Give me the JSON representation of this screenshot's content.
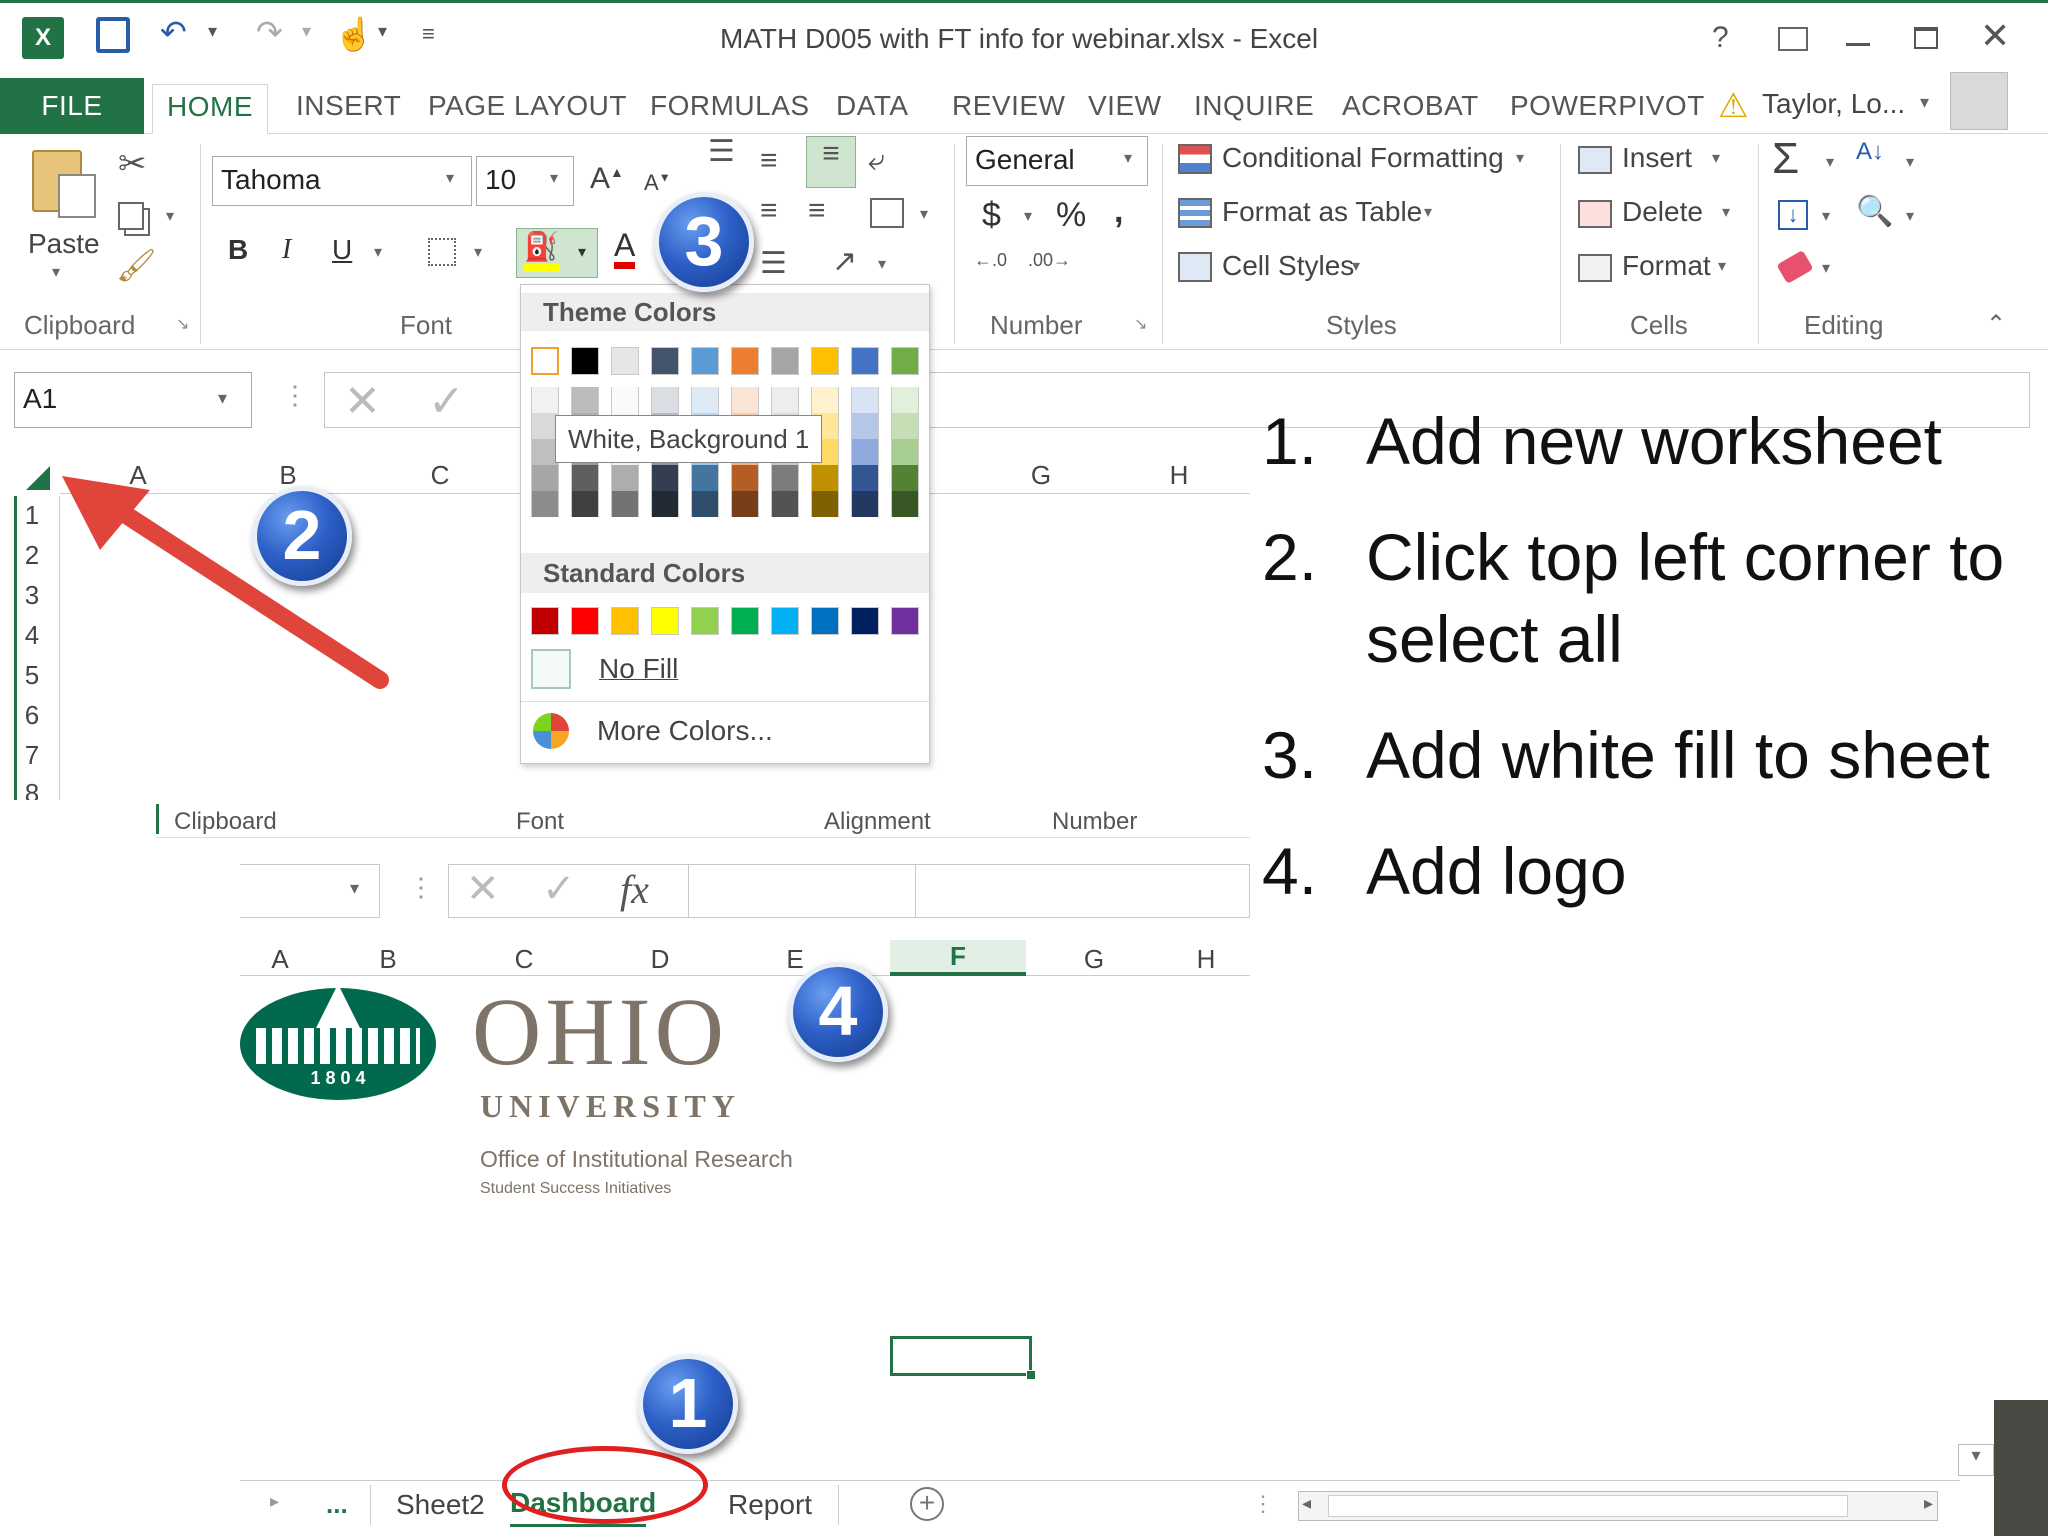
{
  "window": {
    "title": "MATH D005 with FT info for webinar.xlsx - Excel",
    "help": "?",
    "user": "Taylor, Lo..."
  },
  "ribbon_tabs": [
    "FILE",
    "HOME",
    "INSERT",
    "PAGE LAYOUT",
    "FORMULAS",
    "DATA",
    "REVIEW",
    "VIEW",
    "INQUIRE",
    "ACROBAT",
    "POWERPIVOT"
  ],
  "ribbon": {
    "paste": "Paste",
    "font_name": "Tahoma",
    "font_size": "10",
    "bold": "B",
    "italic": "I",
    "underline": "U",
    "number_format": "General",
    "currency": "$",
    "percent": "%",
    "comma": ",",
    "conditional_formatting": "Conditional Formatting",
    "format_as_table": "Format as Table",
    "cell_styles": "Cell Styles",
    "insert": "Insert",
    "delete": "Delete",
    "format": "Format",
    "groups": {
      "clipboard": "Clipboard",
      "font": "Font",
      "number": "Number",
      "styles": "Styles",
      "cells": "Cells",
      "editing": "Editing"
    }
  },
  "name_box": "A1",
  "columns_top": [
    "A",
    "B",
    "C",
    "G",
    "H"
  ],
  "rows": [
    "1",
    "2",
    "3",
    "4",
    "5",
    "6",
    "7",
    "8"
  ],
  "fill_menu": {
    "theme_title": "Theme Colors",
    "tooltip": "White, Background 1",
    "standard_title": "Standard Colors",
    "no_fill": "No Fill",
    "more_colors": "More Colors...",
    "theme_colors": [
      "#ffffff",
      "#000000",
      "#e7e6e6",
      "#44546a",
      "#5b9bd5",
      "#ed7d31",
      "#a5a5a5",
      "#ffc000",
      "#4472c4",
      "#70ad47"
    ],
    "standard_colors": [
      "#c00000",
      "#ff0000",
      "#ffc000",
      "#ffff00",
      "#92d050",
      "#00b050",
      "#00b0f0",
      "#0070c0",
      "#002060",
      "#7030a0"
    ]
  },
  "second": {
    "groups": [
      "Clipboard",
      "Font",
      "Alignment",
      "Number"
    ],
    "fx": "fx",
    "columns": [
      "A",
      "B",
      "C",
      "D",
      "E",
      "F",
      "G",
      "H"
    ]
  },
  "logo": {
    "year": "1 8 0 4",
    "name": "OHIO",
    "sub": "UNIVERSITY",
    "office": "Office of Institutional Research",
    "initiative": "Student Success Initiatives"
  },
  "sheet_tabs": [
    "...",
    "Sheet2",
    "Dashboard",
    "Report"
  ],
  "badges": [
    "1",
    "2",
    "3",
    "4"
  ],
  "steps": [
    {
      "n": "1.",
      "text": "Add new worksheet"
    },
    {
      "n": "2.",
      "text": "Click top left corner to select all"
    },
    {
      "n": "3.",
      "text": "Add white fill to sheet"
    },
    {
      "n": "4.",
      "text": "Add logo"
    }
  ],
  "colors": {
    "excel_green": "#217346",
    "arrow_red": "#e0453c",
    "ohio_green": "#00694e",
    "logo_gray": "#7d7367"
  }
}
